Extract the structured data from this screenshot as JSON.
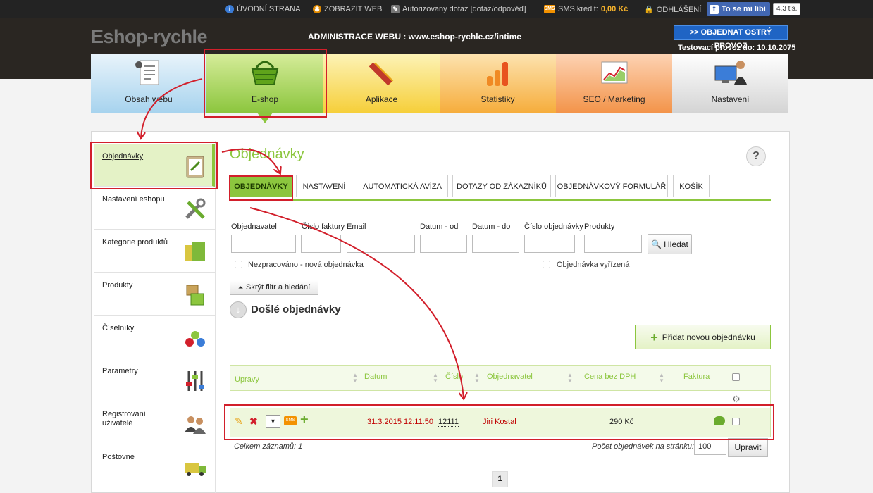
{
  "topbar": {
    "home": "ÚVODNÍ STRANA",
    "view_web": "ZOBRAZIT WEB",
    "query": "Autorizovaný dotaz [dotaz/odpověď]",
    "sms_label": "SMS kredit:",
    "sms_value": "0,00 Kč",
    "logout": "ODHLÁŠENÍ",
    "fb_like": "To se mi líbí",
    "fb_count": "4,3 tis."
  },
  "header": {
    "logo": "Eshop-rychle",
    "admin_title": "ADMINISTRACE WEBU : www.eshop-rychle.cz/intime",
    "order_button": ">> OBJEDNAT OSTRÝ PROVOZ",
    "test_run": "Testovací provoz do: 10.10.2075"
  },
  "nav_tiles": [
    {
      "label": "Obsah webu"
    },
    {
      "label": "E-shop"
    },
    {
      "label": "Aplikace"
    },
    {
      "label": "Statistiky"
    },
    {
      "label": "SEO / Marketing"
    },
    {
      "label": "Nastavení"
    }
  ],
  "sidebar": {
    "items": [
      {
        "label": "Objednávky"
      },
      {
        "label": "Nastavení eshopu"
      },
      {
        "label": "Kategorie produktů"
      },
      {
        "label": "Produkty"
      },
      {
        "label": "Číselníky"
      },
      {
        "label": "Parametry"
      },
      {
        "label": "Registrovaní uživatelé"
      },
      {
        "label": "Poštovné"
      }
    ]
  },
  "main": {
    "title": "Objednávky",
    "help": "?",
    "tabs": [
      {
        "label": "OBJEDNÁVKY"
      },
      {
        "label": "NASTAVENÍ"
      },
      {
        "label": "AUTOMATICKÁ AVÍZA"
      },
      {
        "label": "DOTAZY OD ZÁKAZNÍKŮ"
      },
      {
        "label": "OBJEDNÁVKOVÝ FORMULÁŘ"
      },
      {
        "label": "KOŠÍK"
      }
    ],
    "filters": {
      "objednavatel": "Objednavatel",
      "cislo_faktury": "Číslo faktury",
      "email": "Email",
      "datum_od": "Datum - od",
      "datum_do": "Datum - do",
      "cislo_objednavky": "Číslo objednávky",
      "produkty": "Produkty",
      "search_button": "Hledat",
      "unprocessed": "Nezpracováno - nová objednávka",
      "processed": "Objednávka vyřízená",
      "hide_filter": "Skrýt filtr a hledání"
    },
    "orders_title": "Došlé objednávky",
    "add_order": "Přidat novou objednávku",
    "grid": {
      "columns": {
        "upravy": "Úpravy",
        "datum": "Datum",
        "cislo": "Číslo",
        "objednavatel": "Objednavatel",
        "cena": "Cena bez DPH",
        "faktura": "Faktura"
      },
      "row": {
        "datum": "31.3.2015 12:11:50",
        "cislo": "12111",
        "objednavatel": "Jiri Kostal",
        "cena": "290 Kč",
        "sms": "SMS"
      }
    },
    "total": "Celkem záznamů: 1",
    "per_page_label": "Počet objednávek na stránku:",
    "per_page_value": "100",
    "apply": "Upravit",
    "page": "1"
  },
  "colors": {
    "accent_green": "#8cc63e",
    "annotation_red": "#d21f2b",
    "link_red": "#c00000",
    "header_dark": "#2a2622",
    "button_blue": "#1f64c4"
  }
}
